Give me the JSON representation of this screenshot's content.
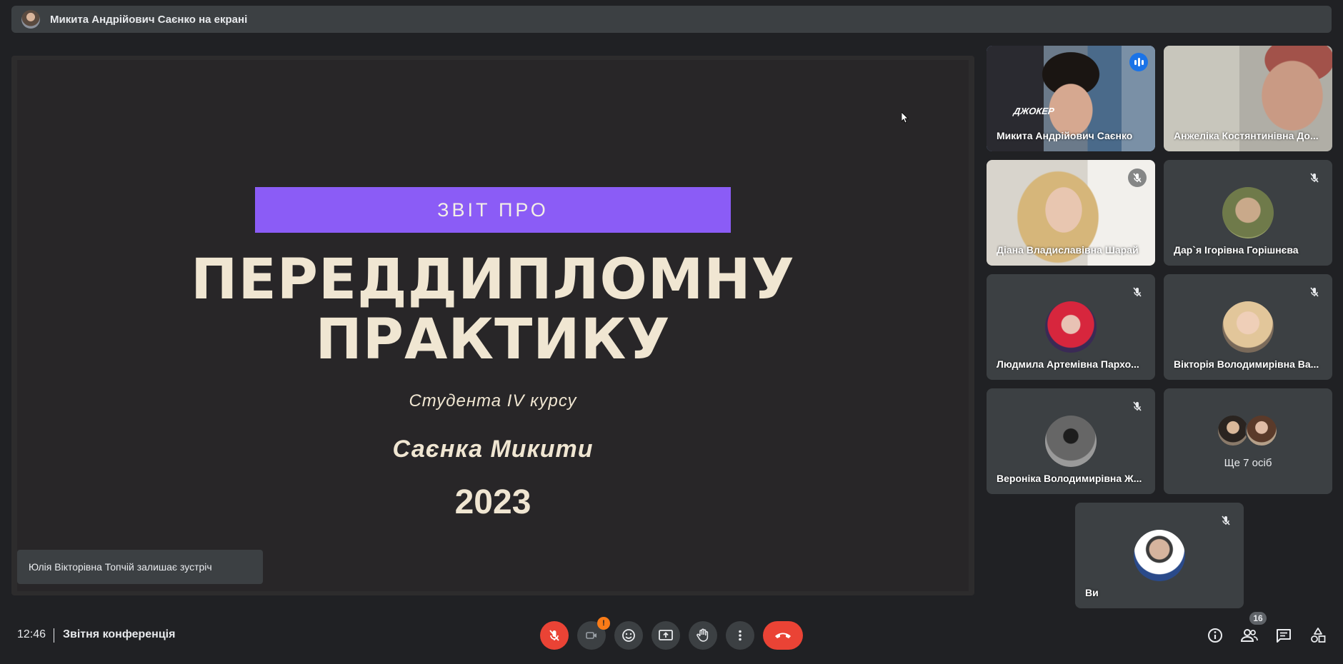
{
  "banner": {
    "text": "Микита Андрійович Саєнко на екрані"
  },
  "slide": {
    "ribbon": "ЗВІТ ПРО",
    "title_line1": "ПЕРЕДДИПЛОМНУ",
    "title_line2": "ПРАКТИКУ",
    "subtitle": "Студента IV курсу",
    "name": "Саєнка Микити",
    "year": "2023"
  },
  "toast": {
    "text": "Юлія Вікторівна Топчій залишає зустріч"
  },
  "participants": [
    {
      "name": "Микита Андрійович Саєнко",
      "status": "speaking",
      "poster": "ДЖОКЕР"
    },
    {
      "name": "Анжеліка Костянтинівна До...",
      "status": "video"
    },
    {
      "name": "Діана Владиславівна Шарай",
      "status": "muted"
    },
    {
      "name": "Дар`я Ігорівна Горішнєва",
      "status": "muted"
    },
    {
      "name": "Людмила Артемівна Пархо...",
      "status": "muted"
    },
    {
      "name": "Вікторія Володимирівна Ва...",
      "status": "muted"
    },
    {
      "name": "Вероніка Володимирівна Ж...",
      "status": "muted"
    },
    {
      "name": "Ще 7 осіб",
      "status": "group"
    },
    {
      "name": "Ви",
      "status": "muted"
    }
  ],
  "bottom_bar": {
    "time": "12:46",
    "meeting_title": "Звітня конференція",
    "camera_warning": "!",
    "participant_count": "16"
  },
  "colors": {
    "background": "#202124",
    "tile": "#3c4043",
    "accent_red": "#ea4335",
    "speaking_blue": "#1a73e8",
    "ribbon_purple": "#8b5cf6",
    "slide_text": "#f0e6d2"
  }
}
